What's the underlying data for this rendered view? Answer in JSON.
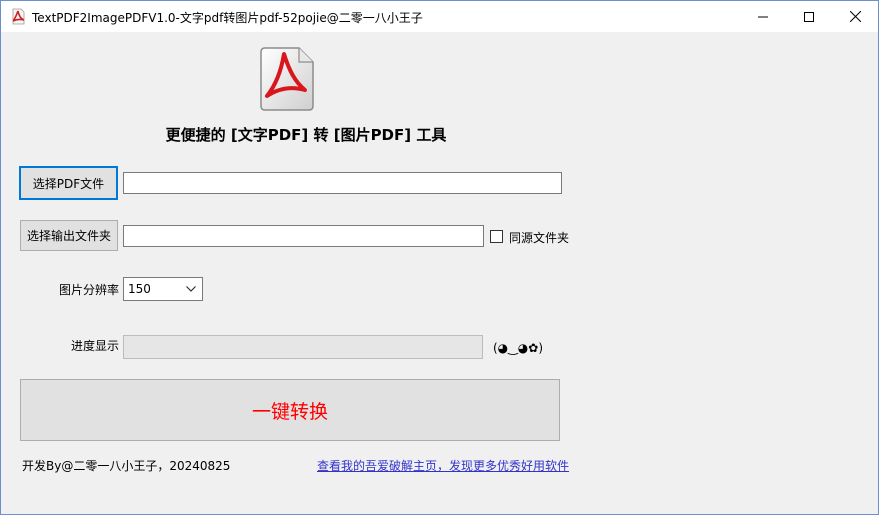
{
  "window": {
    "title": "TextPDF2ImagePDFV1.0-文字pdf转图片pdf-52pojie@二零一八小王子",
    "controls": [
      "minimize-icon",
      "maximize-icon",
      "close-icon"
    ]
  },
  "header": {
    "logo_icon": "acrobat-pdf-icon",
    "headline": "更便捷的 [文字PDF] 转 [图片PDF] 工具"
  },
  "form": {
    "select_pdf_button": "选择PDF文件",
    "pdf_path_value": "",
    "select_output_button": "选择输出文件夹",
    "output_path_value": "",
    "same_source_label": "同源文件夹",
    "same_source_checked": false,
    "resolution_label": "图片分辨率",
    "resolution_value": "150",
    "progress_label": "进度显示",
    "progress_percent": 0,
    "progress_emoticon": "(◕‿◕✿)"
  },
  "actions": {
    "convert_button": "一键转换"
  },
  "footer": {
    "developer_text": "开发By@二零一八小王子，20240825",
    "link_text": "查看我的吾爱破解主页，发现更多优秀好用软件"
  },
  "colors": {
    "accent": "#0078d7",
    "convert_text": "#ff0000",
    "link": "#3333cc",
    "window_bg": "#f0f0f0"
  }
}
